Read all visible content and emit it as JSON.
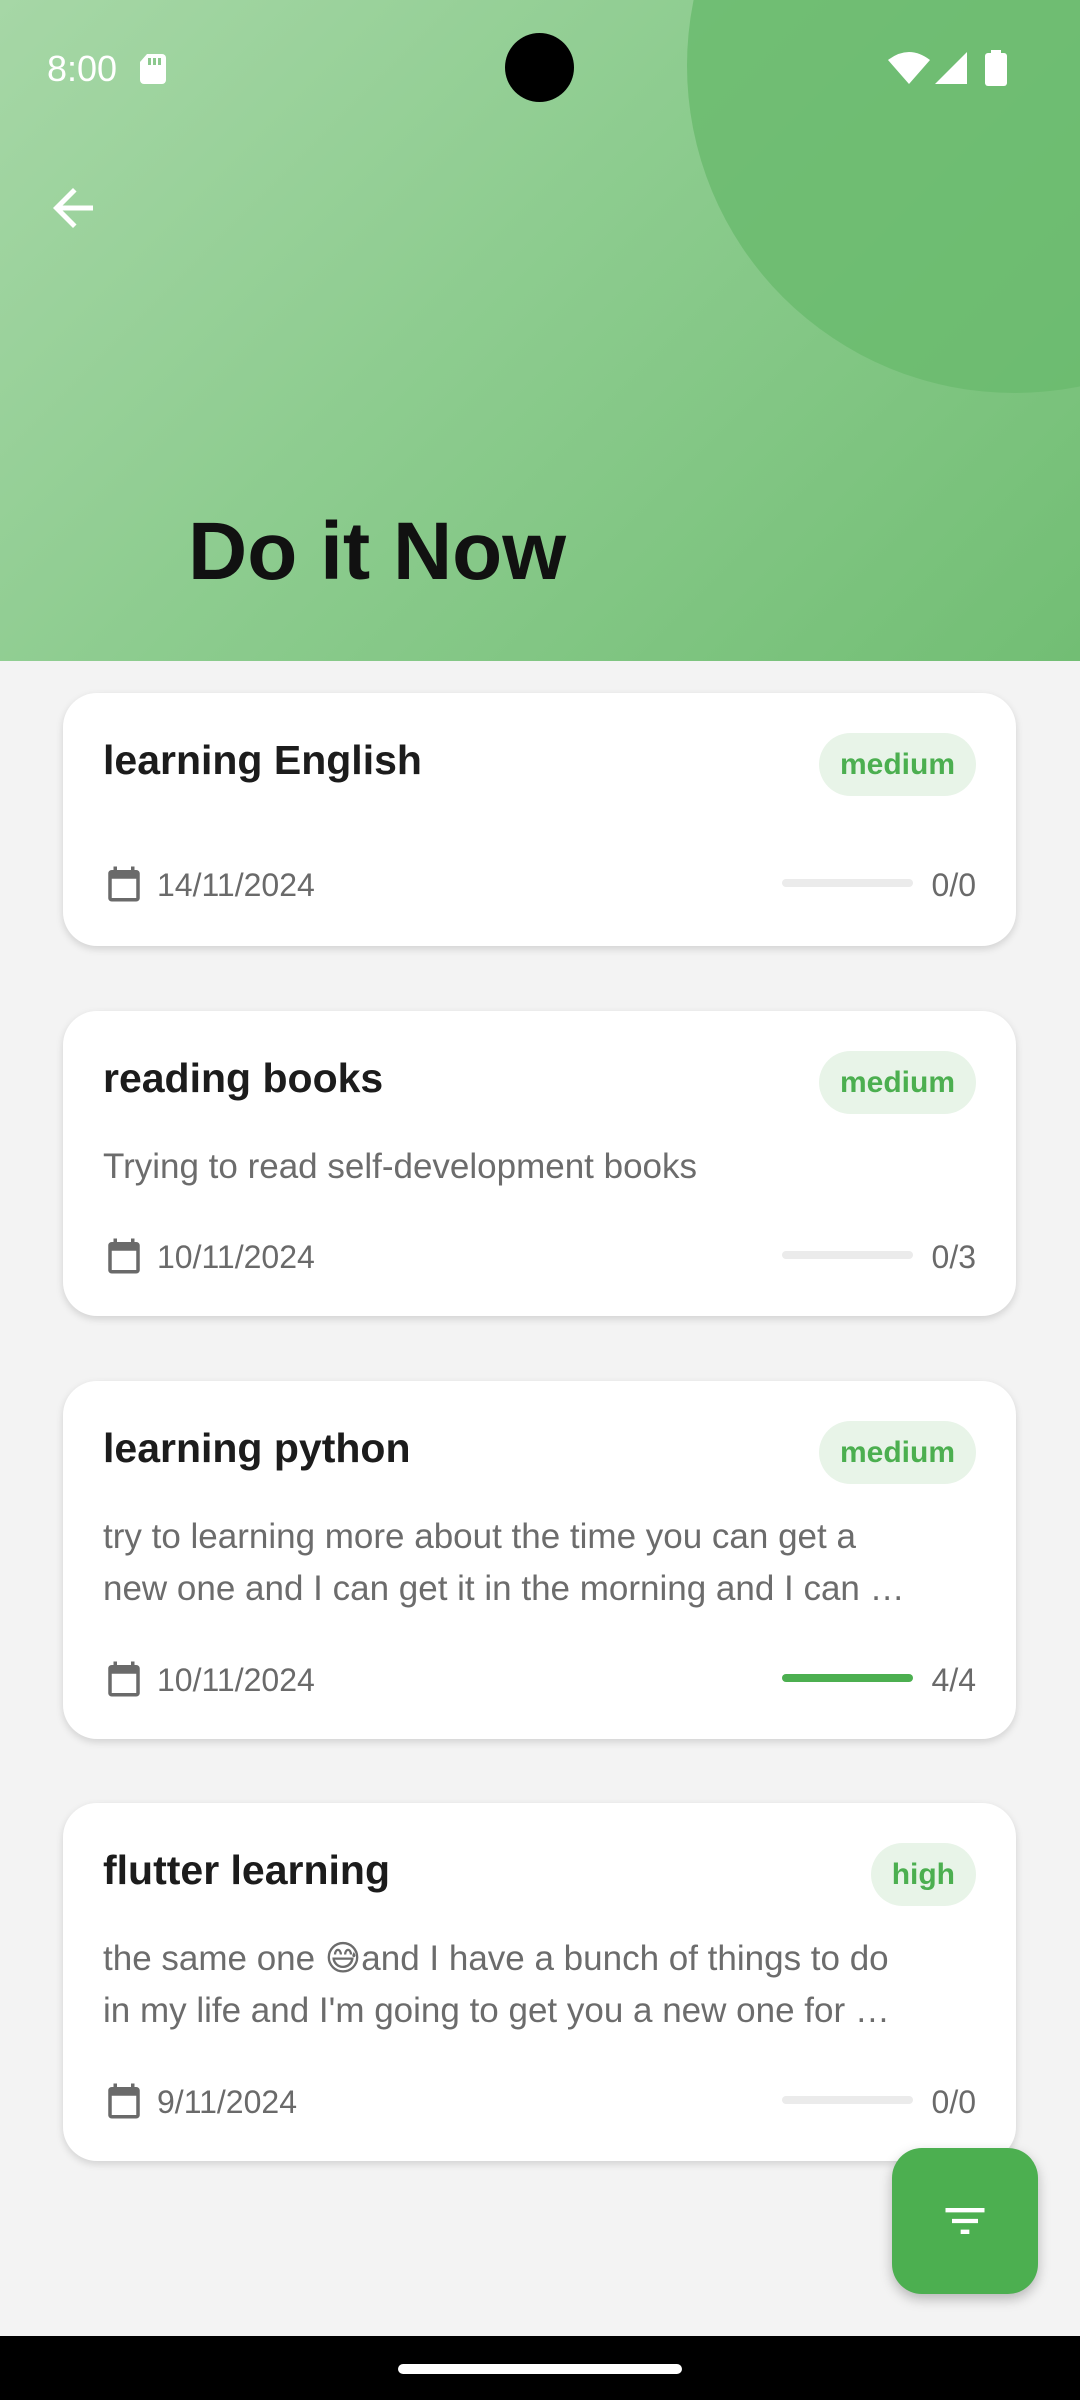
{
  "status_bar": {
    "time": "8:00"
  },
  "header": {
    "title": "Do it Now"
  },
  "tasks": [
    {
      "title": "learning English",
      "priority": "medium",
      "description": [],
      "date": "14/11/2024",
      "progress_text": "0/0",
      "progress": 0
    },
    {
      "title": "reading books",
      "priority": "medium",
      "description": [
        "Trying to read self-development books"
      ],
      "date": "10/11/2024",
      "progress_text": "0/3",
      "progress": 0
    },
    {
      "title": "learning python",
      "priority": "medium",
      "description": [
        "try to learning more about the time you can get a",
        "new one and I can get it in the morning and I can …"
      ],
      "date": "10/11/2024",
      "progress_text": "4/4",
      "progress": 1
    },
    {
      "title": "flutter learning",
      "priority": "high",
      "description": [
        "the same one 😅and I have a bunch of things to do",
        "in my life and I'm going to get you a new one for …"
      ],
      "date": "9/11/2024",
      "progress_text": "0/0",
      "progress": 0
    }
  ],
  "colors": {
    "accent": "#4caf50",
    "badge_bg": "#e8f4e8",
    "header_start": "#a6d7a6",
    "header_end": "#72be74"
  },
  "icons": {
    "back": "arrow-left-icon",
    "calendar": "calendar-icon",
    "filter": "filter-icon"
  }
}
